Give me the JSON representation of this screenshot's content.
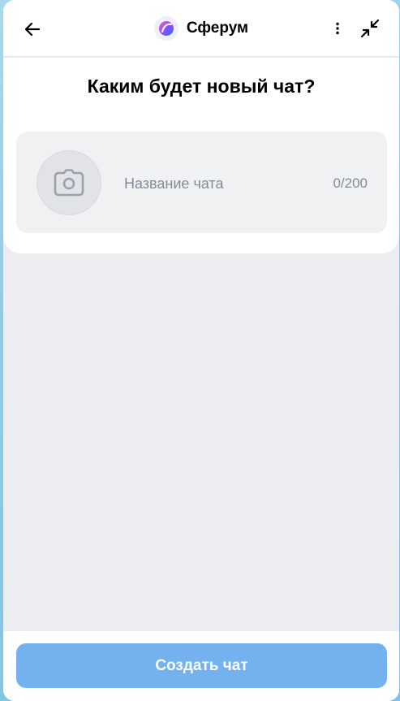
{
  "header": {
    "back_icon": "arrow-left-icon",
    "app_title": "Сферум",
    "logo_icon": "sferum-logo-icon",
    "more_icon": "more-vertical-icon",
    "collapse_icon": "collapse-arrows-icon"
  },
  "main": {
    "title": "Каким будет новый чат?",
    "avatar_icon": "camera-icon",
    "chat_name_placeholder": "Название чата",
    "chat_name_value": "",
    "counter": "0/200"
  },
  "footer": {
    "create_button_label": "Создать чат"
  },
  "colors": {
    "accent_disabled": "#74b2ef",
    "background": "#ebedf0",
    "placeholder": "#818c99"
  }
}
